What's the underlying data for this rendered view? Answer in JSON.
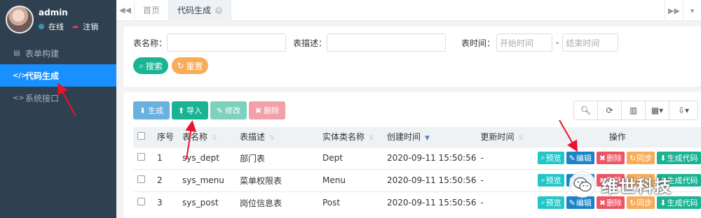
{
  "user": {
    "name": "admin",
    "status": "在线",
    "logout": "注销"
  },
  "sidebar": {
    "items": [
      {
        "label": "表单构建",
        "icon": "form-icon",
        "active": false
      },
      {
        "label": "代码生成",
        "icon": "code-icon",
        "active": true
      },
      {
        "label": "系统接口",
        "icon": "api-icon",
        "active": false
      }
    ]
  },
  "tabs": {
    "home": "首页",
    "current": "代码生成"
  },
  "search": {
    "table_name_label": "表名称：",
    "table_desc_label": "表描述：",
    "table_time_label": "表时间：",
    "start_placeholder": "开始时间",
    "range_sep": "-",
    "end_placeholder": "结束时间",
    "search_btn": "搜索",
    "reset_btn": "重置"
  },
  "toolbar": {
    "generate": "生成",
    "import": "导入",
    "edit": "修改",
    "delete": "删除"
  },
  "table": {
    "headers": {
      "index": "序号",
      "name": "表名称",
      "desc": "表描述",
      "entity": "实体类名称",
      "created": "创建时间",
      "updated": "更新时间",
      "ops": "操作"
    },
    "rows": [
      {
        "index": "1",
        "name": "sys_dept",
        "desc": "部门表",
        "entity": "Dept",
        "created": "2020-09-11 15:50:56",
        "updated": "-"
      },
      {
        "index": "2",
        "name": "sys_menu",
        "desc": "菜单权限表",
        "entity": "Menu",
        "created": "2020-09-11 15:50:56",
        "updated": "-"
      },
      {
        "index": "3",
        "name": "sys_post",
        "desc": "岗位信息表",
        "entity": "Post",
        "created": "2020-09-11 15:50:56",
        "updated": "-"
      }
    ],
    "ops": {
      "preview": "预览",
      "edit": "编辑",
      "delete": "删除",
      "sync": "同步",
      "gen": "生成代码"
    }
  },
  "watermark": "维世科技",
  "colors": {
    "sidebar": "#2f4050",
    "active": "#1890ff",
    "primary": "#1ab394",
    "warning": "#f8ac59",
    "danger": "#ed5565",
    "info": "#23c6c8",
    "edit": "#1c84c6"
  }
}
